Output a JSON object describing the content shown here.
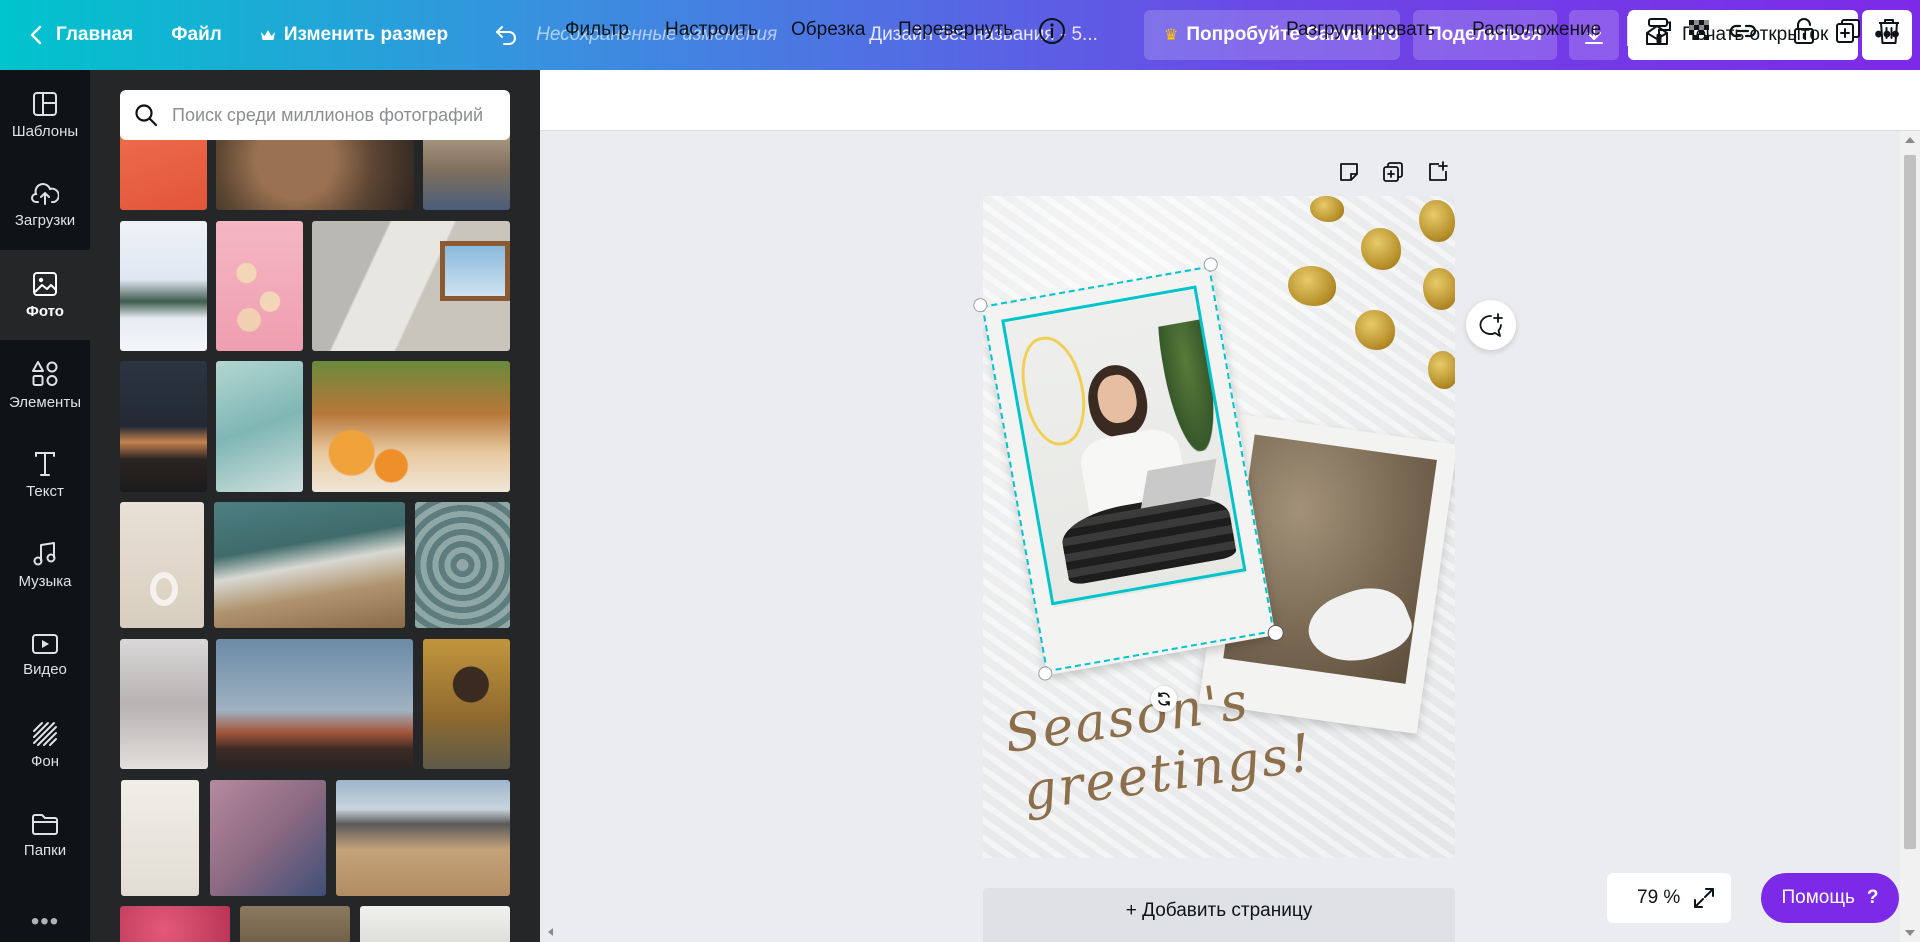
{
  "header": {
    "home_label": "Главная",
    "file_label": "Файл",
    "resize_label": "Изменить размер",
    "unsaved_label": "Несохраненные изменения",
    "design_title": "Дизайн без названия - 5...",
    "pro_label": "Попробуйте Canva Pro",
    "share_label": "Поделиться",
    "print_label": "Печать открыток",
    "more_label": "•••"
  },
  "sidebar": {
    "items": [
      {
        "label": "Шаблоны",
        "icon": "templates-icon"
      },
      {
        "label": "Загрузки",
        "icon": "upload-cloud-icon"
      },
      {
        "label": "Фото",
        "icon": "photo-icon",
        "active": true
      },
      {
        "label": "Элементы",
        "icon": "elements-icon"
      },
      {
        "label": "Текст",
        "icon": "text-icon"
      },
      {
        "label": "Музыка",
        "icon": "music-icon"
      },
      {
        "label": "Видео",
        "icon": "video-icon"
      },
      {
        "label": "Фон",
        "icon": "background-icon"
      },
      {
        "label": "Папки",
        "icon": "folder-icon"
      }
    ],
    "more_label": "•••"
  },
  "photos": {
    "search_placeholder": "Поиск среди миллионов фотографий"
  },
  "toolbar": {
    "filter_label": "Фильтр",
    "adjust_label": "Настроить",
    "crop_label": "Обрезка",
    "flip_label": "Перевернуть",
    "ungroup_label": "Разгруппировать",
    "position_label": "Расположение"
  },
  "canvas": {
    "greeting_line1": "Season's",
    "greeting_line2": "greetings!",
    "add_page_label": "+ Добавить страницу"
  },
  "footer": {
    "zoom_label": "79 %",
    "help_label": "Помощь",
    "help_icon_label": "?"
  },
  "colors": {
    "accent_purple": "#7d2ae8",
    "accent_teal": "#00c4cc",
    "selection": "#00c4cc",
    "greeting_text": "#8c6e4a"
  }
}
